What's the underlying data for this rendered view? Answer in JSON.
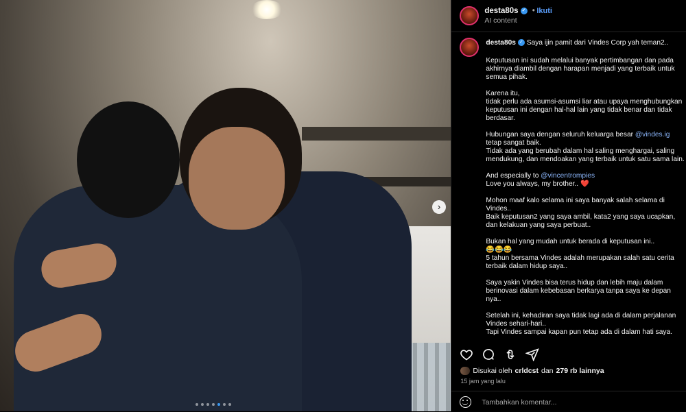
{
  "post": {
    "username": "desta80s",
    "follow_label": "Ikuti",
    "ai_label": "AI content",
    "caption_first_line": "Saya ijin pamit dari Vindes Corp yah teman2..",
    "paragraphs": [
      "Keputusan ini sudah melalui banyak pertimbangan dan pada akhirnya diambil dengan harapan menjadi yang terbaik untuk semua pihak.",
      "Karena itu,\ntidak perlu ada asumsi-asumsi liar atau upaya menghubungkan keputusan ini dengan hal-hal lain yang tidak benar dan tidak berdasar.",
      "Hubungan saya dengan seluruh keluarga besar @vindes.ig tetap sangat baik.\nTidak ada yang berubah dalam hal saling menghargai, saling mendukung, dan mendoakan yang terbaik untuk satu sama lain.",
      "And especially to @vincentrompies\nLove you always, my brother.. ❤️",
      "Mohon maaf kalo selama ini saya banyak salah selama di Vindes..\nBaik keputusan2 yang saya ambil, kata2 yang saya ucapkan, dan kelakuan yang saya perbuat..",
      "Bukan hal yang mudah untuk berada di keputusan ini..\n😂😂😂\n5 tahun bersama Vindes adalah merupakan salah satu cerita terbaik dalam hidup saya..",
      "Saya yakin Vindes bisa terus hidup dan lebih maju dalam berinovasi dalam kebebasan berkarya tanpa saya ke depan nya..",
      "Setelah ini, kehadiran saya tidak lagi ada di dalam perjalanan Vindes sehari-hari..\nTapi Vindes sampai kapan pun tetap ada di dalam hati saya."
    ],
    "likes": {
      "prefix": "Disukai oleh",
      "user": "crldcst",
      "middle": "dan",
      "count": "279 rb lainnya"
    },
    "time": "15 jam yang lalu",
    "comment_placeholder": "Tambahkan komentar...",
    "carousel": {
      "total": 7,
      "active": 5
    }
  },
  "colors": {
    "background": "#000000",
    "link": "#5a9cf8",
    "verified": "#3897f0",
    "muted": "#a8a8a8"
  },
  "icons": [
    "heart-icon",
    "comment-icon",
    "share-icon",
    "send-icon",
    "emoji-icon",
    "verified-icon",
    "chevron-right-icon"
  ]
}
